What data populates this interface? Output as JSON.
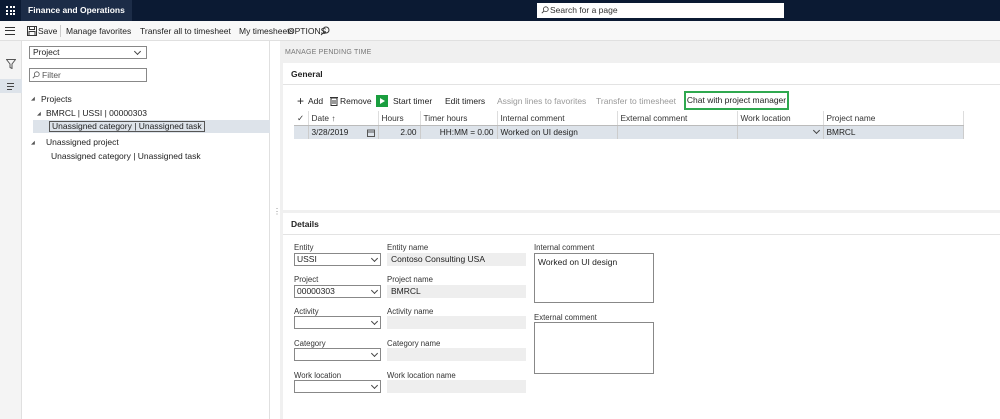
{
  "app": {
    "name": "Finance and Operations",
    "search_placeholder": "Search for a page"
  },
  "actionbar": {
    "save": "Save",
    "manage_favorites": "Manage favorites",
    "transfer_all": "Transfer all to timesheet",
    "my_timesheets": "My timesheets",
    "options": "OPTIONS"
  },
  "leftpane": {
    "view_select": "Project",
    "filter_placeholder": "Filter",
    "tree": {
      "root": "Projects",
      "project": "BMRCL | USSI | 00000303",
      "project_task": "Unassigned category | Unassigned task",
      "unassigned_project": "Unassigned project",
      "unassigned_task": "Unassigned category | Unassigned task"
    }
  },
  "page_title": "MANAGE PENDING TIME",
  "general": {
    "header": "General",
    "toolbar": {
      "add": "Add",
      "remove": "Remove",
      "start_timer": "Start timer",
      "edit_timers": "Edit timers",
      "assign_lines": "Assign lines to favorites",
      "transfer": "Transfer to timesheet",
      "chat": "Chat with project manager"
    },
    "columns": {
      "date": "Date",
      "sort_icon": "↑",
      "hours": "Hours",
      "timer_hours": "Timer hours",
      "internal_comment": "Internal comment",
      "external_comment": "External comment",
      "work_location": "Work location",
      "project_name": "Project name"
    },
    "rows": [
      {
        "date": "3/28/2019",
        "hours": "2.00",
        "timer_hours": "HH:MM = 0.00",
        "internal_comment": "Worked on UI design",
        "external_comment": "",
        "work_location": "",
        "project_name": "BMRCL"
      }
    ]
  },
  "details": {
    "header": "Details",
    "entity_label": "Entity",
    "entity_value": "USSI",
    "entity_name_label": "Entity name",
    "entity_name_value": "Contoso Consulting USA",
    "project_label": "Project",
    "project_value": "00000303",
    "project_name_label": "Project name",
    "project_name_value": "BMRCL",
    "activity_label": "Activity",
    "activity_value": "",
    "activity_name_label": "Activity name",
    "activity_name_value": "",
    "category_label": "Category",
    "category_value": "",
    "category_name_label": "Category name",
    "category_name_value": "",
    "work_location_label": "Work location",
    "work_location_value": "",
    "work_location_name_label": "Work location name",
    "work_location_name_value": "",
    "internal_comment_label": "Internal comment",
    "internal_comment_value": "Worked on UI design",
    "external_comment_label": "External comment",
    "external_comment_value": ""
  },
  "colors": {
    "topbar": "#0b1a33",
    "accent_green": "#2fa84f",
    "selected_row": "#dde3ea"
  }
}
